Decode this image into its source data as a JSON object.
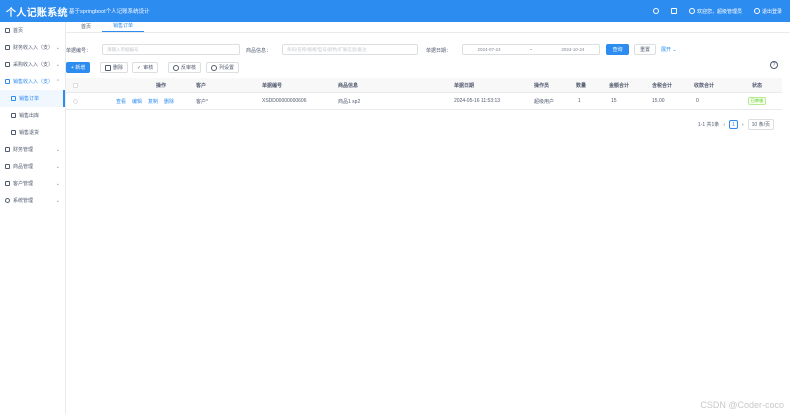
{
  "app": {
    "title": "个人记账系统",
    "subtitle": "基于springboot个人记账系统设计"
  },
  "header": {
    "right_items": [
      {
        "icon": "search-icon",
        "label": ""
      },
      {
        "icon": "bell-icon",
        "label": ""
      },
      {
        "icon": "user-icon",
        "label": "欢迎您，超级管理员"
      },
      {
        "icon": "logout-icon",
        "label": "退出登录"
      }
    ]
  },
  "sidebar": {
    "items": [
      {
        "label": "首页",
        "icon": "home-icon",
        "sub": false,
        "chev": "",
        "state": ""
      },
      {
        "label": "财务收入入（支）",
        "icon": "grid-icon",
        "sub": false,
        "chev": "⌄",
        "state": ""
      },
      {
        "label": "采购收入入（支）",
        "icon": "grid-icon",
        "sub": false,
        "chev": "⌄",
        "state": ""
      },
      {
        "label": "销售收入入（支）",
        "icon": "grid-icon",
        "sub": false,
        "chev": "⌃",
        "state": "open"
      },
      {
        "label": "销售订单",
        "icon": "doc-icon",
        "sub": true,
        "chev": "",
        "state": "active"
      },
      {
        "label": "销售出库",
        "icon": "doc-icon",
        "sub": true,
        "chev": "",
        "state": ""
      },
      {
        "label": "销售退货",
        "icon": "doc-icon",
        "sub": true,
        "chev": "",
        "state": ""
      },
      {
        "label": "财务管理",
        "icon": "grid-icon",
        "sub": false,
        "chev": "⌄",
        "state": ""
      },
      {
        "label": "商品管理",
        "icon": "grid-icon",
        "sub": false,
        "chev": "⌄",
        "state": ""
      },
      {
        "label": "客户管理",
        "icon": "grid-icon",
        "sub": false,
        "chev": "⌄",
        "state": ""
      },
      {
        "label": "系统管理",
        "icon": "gear-icon",
        "sub": false,
        "chev": "⌄",
        "state": ""
      }
    ]
  },
  "tabs": [
    {
      "label": "首页"
    },
    {
      "label": "销售订单"
    }
  ],
  "filters": {
    "order_no_label": "单据编号：",
    "order_no_placeholder": "请输入单据编号",
    "product_label": "商品信息：",
    "product_placeholder": "条码/名称/规格/型号/颜色/扩展信息/备注",
    "date_label": "单据日期：",
    "date_start": "2024-07-24",
    "date_end": "2024-10-24",
    "search_label": "查询",
    "reset_label": "重置",
    "expand_label": "展开 ⌄"
  },
  "toolbar": {
    "add_label": "+ 新增",
    "delete_label": "删除",
    "audit_label": "审核",
    "unaudit_label": "反审核",
    "columns_label": "列设置"
  },
  "table": {
    "headers": [
      "操作",
      "客户",
      "单据编号",
      "商品信息",
      "单据日期",
      "操作员",
      "数量",
      "金额合计",
      "含税合计",
      "收款合计",
      "状态"
    ],
    "ops": [
      "查看",
      "编辑",
      "复制",
      "删除"
    ],
    "rows": [
      {
        "customer": "客户*",
        "order_no": "XSDD00000000606",
        "product": "商品1 sp2",
        "date": "2024-05-16 11:53:13",
        "operator": "超级用户",
        "qty": "1",
        "amount": "15",
        "tax_total": "15.00",
        "received": "0",
        "status": "已审核"
      }
    ]
  },
  "pager": {
    "total": "1-1 共1条",
    "prev": "‹",
    "page": "1",
    "next": "›",
    "size": "10 条/页"
  },
  "watermark": "CSDN @Coder-coco",
  "colors": {
    "primary": "#2d8cf0",
    "success": "#52c41a",
    "sidebar_bg": "#ffffff"
  }
}
